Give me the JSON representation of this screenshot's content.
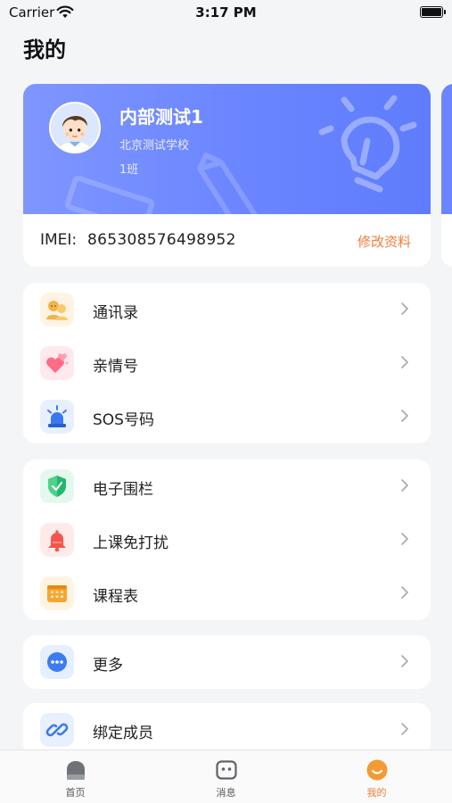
{
  "status_bar": {
    "carrier": "Carrier",
    "time": "3:17 PM"
  },
  "page_title": "我的",
  "profile": {
    "name": "内部测试1",
    "school": "北京测试学校",
    "class": "1班",
    "imei_label": "IMEI:",
    "imei_value": "865308576498952",
    "edit_label": "修改资料"
  },
  "menu_groups": [
    {
      "items": [
        {
          "label": "通讯录",
          "icon": "contacts-icon"
        },
        {
          "label": "亲情号",
          "icon": "family-hearts-icon"
        },
        {
          "label": "SOS号码",
          "icon": "sos-alarm-icon"
        }
      ]
    },
    {
      "items": [
        {
          "label": "电子围栏",
          "icon": "shield-icon"
        },
        {
          "label": "上课免打扰",
          "icon": "bell-icon"
        },
        {
          "label": "课程表",
          "icon": "timetable-icon"
        }
      ]
    },
    {
      "items": [
        {
          "label": "更多",
          "icon": "more-dots-icon"
        }
      ]
    },
    {
      "items": [
        {
          "label": "绑定成员",
          "icon": "link-icon"
        }
      ]
    }
  ],
  "tabs": [
    {
      "label": "首页",
      "icon": "home-icon"
    },
    {
      "label": "消息",
      "icon": "message-icon"
    },
    {
      "label": "我的",
      "icon": "smiley-icon",
      "active": true
    }
  ],
  "colors": {
    "accent": "#f07c3a",
    "banner": "#6a85ff"
  }
}
